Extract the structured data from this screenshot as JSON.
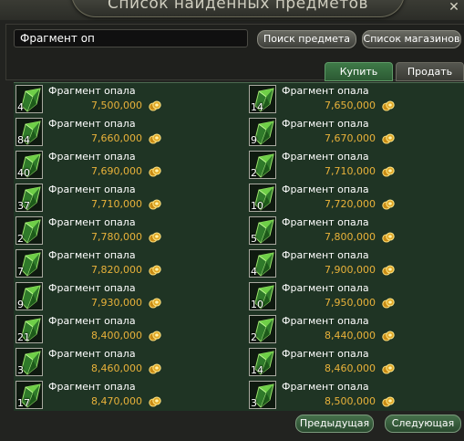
{
  "window": {
    "title": "Список найденных предметов"
  },
  "search": {
    "value": "Фрагмент оп"
  },
  "buttons": {
    "search": "Поиск предмета",
    "shops": "Список магазинов",
    "prev": "Предыдущая",
    "next": "Следующая"
  },
  "tabs": {
    "buy": "Купить",
    "sell": "Продать",
    "active": "buy"
  },
  "items": [
    {
      "name": "Фрагмент опала",
      "count": "4",
      "price": "7,500,000",
      "icon": "gem-fragment-icon"
    },
    {
      "name": "Фрагмент опала",
      "count": "14",
      "price": "7,650,000",
      "icon": "gem-fragment-icon"
    },
    {
      "name": "Фрагмент опала",
      "count": "84",
      "price": "7,660,000",
      "icon": "gem-fragment-icon"
    },
    {
      "name": "Фрагмент опала",
      "count": "9",
      "price": "7,670,000",
      "icon": "gem-fragment-icon"
    },
    {
      "name": "Фрагмент опала",
      "count": "40",
      "price": "7,690,000",
      "icon": "gem-fragment-icon"
    },
    {
      "name": "Фрагмент опала",
      "count": "2",
      "price": "7,710,000",
      "icon": "gem-fragment-icon"
    },
    {
      "name": "Фрагмент опала",
      "count": "37",
      "price": "7,710,000",
      "icon": "gem-fragment-icon"
    },
    {
      "name": "Фрагмент опала",
      "count": "10",
      "price": "7,720,000",
      "icon": "gem-fragment-icon"
    },
    {
      "name": "Фрагмент опала",
      "count": "2",
      "price": "7,780,000",
      "icon": "gem-fragment-icon"
    },
    {
      "name": "Фрагмент опала",
      "count": "5",
      "price": "7,800,000",
      "icon": "gem-fragment-icon"
    },
    {
      "name": "Фрагмент опала",
      "count": "7",
      "price": "7,820,000",
      "icon": "gem-fragment-icon"
    },
    {
      "name": "Фрагмент опала",
      "count": "4",
      "price": "7,900,000",
      "icon": "gem-fragment-icon"
    },
    {
      "name": "Фрагмент опала",
      "count": "9",
      "price": "7,930,000",
      "icon": "gem-fragment-icon"
    },
    {
      "name": "Фрагмент опала",
      "count": "10",
      "price": "7,950,000",
      "icon": "gem-fragment-icon"
    },
    {
      "name": "Фрагмент опала",
      "count": "21",
      "price": "8,400,000",
      "icon": "gem-fragment-icon"
    },
    {
      "name": "Фрагмент опала",
      "count": "2",
      "price": "8,440,000",
      "icon": "gem-fragment-icon"
    },
    {
      "name": "Фрагмент опала",
      "count": "3",
      "price": "8,460,000",
      "icon": "gem-fragment-icon"
    },
    {
      "name": "Фрагмент опала",
      "count": "14",
      "price": "8,460,000",
      "icon": "gem-fragment-icon"
    },
    {
      "name": "Фрагмент опала",
      "count": "17",
      "price": "8,470,000",
      "icon": "gem-fragment-icon"
    },
    {
      "name": "Фрагмент опала",
      "count": "3",
      "price": "8,500,000",
      "icon": "gem-fragment-icon"
    }
  ],
  "colors": {
    "price": "#e9b23a",
    "list_bg": "#1f3424",
    "tab_active": "#3f7a48"
  }
}
